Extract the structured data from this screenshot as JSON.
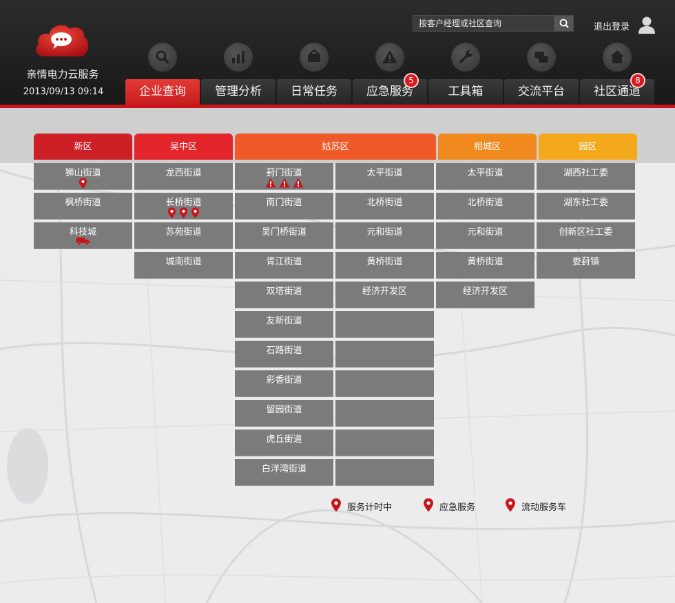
{
  "app": {
    "name": "亲情电力云服务",
    "datetime": "2013/09/13 09:14",
    "logo_icon": "chat-cloud-icon",
    "brand_color": "#c8151c"
  },
  "header": {
    "search_placeholder": "按客户经理或社区查询",
    "search_icon": "search-icon",
    "logout_label": "退出登录",
    "user_icon": "user-icon"
  },
  "nav": [
    {
      "label": "企业查询",
      "icon": "search-icon",
      "active": true,
      "badge": null
    },
    {
      "label": "管理分析",
      "icon": "bar-chart-icon",
      "active": false,
      "badge": null
    },
    {
      "label": "日常任务",
      "icon": "tasks-icon",
      "active": false,
      "badge": null
    },
    {
      "label": "应急服务",
      "icon": "warning-icon",
      "active": false,
      "badge": "5"
    },
    {
      "label": "工具箱",
      "icon": "wrench-icon",
      "active": false,
      "badge": null
    },
    {
      "label": "交流平台",
      "icon": "chat-icon",
      "active": false,
      "badge": null
    },
    {
      "label": "社区通道",
      "icon": "home-icon",
      "active": false,
      "badge": "8"
    }
  ],
  "districts": [
    {
      "name": "新区",
      "color": "#cc1f26",
      "cols": [
        [
          {
            "label": "狮山街道",
            "marks": [
              "pin"
            ]
          },
          {
            "label": "枫桥街道",
            "marks": []
          },
          {
            "label": "科技城",
            "marks": [
              "truck"
            ]
          }
        ]
      ]
    },
    {
      "name": "吴中区",
      "color": "#e3242b",
      "cols": [
        [
          {
            "label": "龙西街道",
            "marks": []
          },
          {
            "label": "长桥街道",
            "marks": [
              "pin",
              "pin",
              "pin"
            ]
          },
          {
            "label": "苏苑街道",
            "marks": []
          },
          {
            "label": "城南街道",
            "marks": []
          }
        ]
      ]
    },
    {
      "name": "姑苏区",
      "color": "#ef5a28",
      "cols": [
        [
          {
            "label": "葑门街道",
            "marks": [
              "warning",
              "warning",
              "warning"
            ]
          },
          {
            "label": "南门街道",
            "marks": []
          },
          {
            "label": "吴门桥街道",
            "marks": []
          },
          {
            "label": "胥江街道",
            "marks": []
          },
          {
            "label": "双塔街道",
            "marks": []
          },
          {
            "label": "友新街道",
            "marks": []
          },
          {
            "label": "石路街道",
            "marks": []
          },
          {
            "label": "彩香街道",
            "marks": []
          },
          {
            "label": "留园街道",
            "marks": []
          },
          {
            "label": "虎丘街道",
            "marks": []
          },
          {
            "label": "白洋湾街道",
            "marks": []
          }
        ],
        [
          {
            "label": "太平街道",
            "marks": []
          },
          {
            "label": "北桥街道",
            "marks": []
          },
          {
            "label": "元和街道",
            "marks": []
          },
          {
            "label": "黄桥街道",
            "marks": []
          },
          {
            "label": "经济开发区",
            "marks": []
          },
          {
            "label": "",
            "marks": []
          },
          {
            "label": "",
            "marks": []
          },
          {
            "label": "",
            "marks": []
          },
          {
            "label": "",
            "marks": []
          },
          {
            "label": "",
            "marks": []
          },
          {
            "label": "",
            "marks": []
          }
        ]
      ]
    },
    {
      "name": "相城区",
      "color": "#f08a1e",
      "cols": [
        [
          {
            "label": "太平街道",
            "marks": []
          },
          {
            "label": "北桥街道",
            "marks": []
          },
          {
            "label": "元和街道",
            "marks": []
          },
          {
            "label": "黄桥街道",
            "marks": []
          },
          {
            "label": "经济开发区",
            "marks": []
          }
        ]
      ]
    },
    {
      "name": "园区",
      "color": "#f4a91c",
      "cols": [
        [
          {
            "label": "湖西社工委",
            "marks": []
          },
          {
            "label": "湖东社工委",
            "marks": []
          },
          {
            "label": "创新区社工委",
            "marks": []
          },
          {
            "label": "娄葑镇",
            "marks": []
          }
        ]
      ]
    }
  ],
  "legend": [
    {
      "label": "服务计时中",
      "icon": "map-pin-icon"
    },
    {
      "label": "应急服务",
      "icon": "map-pin-icon"
    },
    {
      "label": "流动服务车",
      "icon": "map-pin-icon"
    }
  ]
}
